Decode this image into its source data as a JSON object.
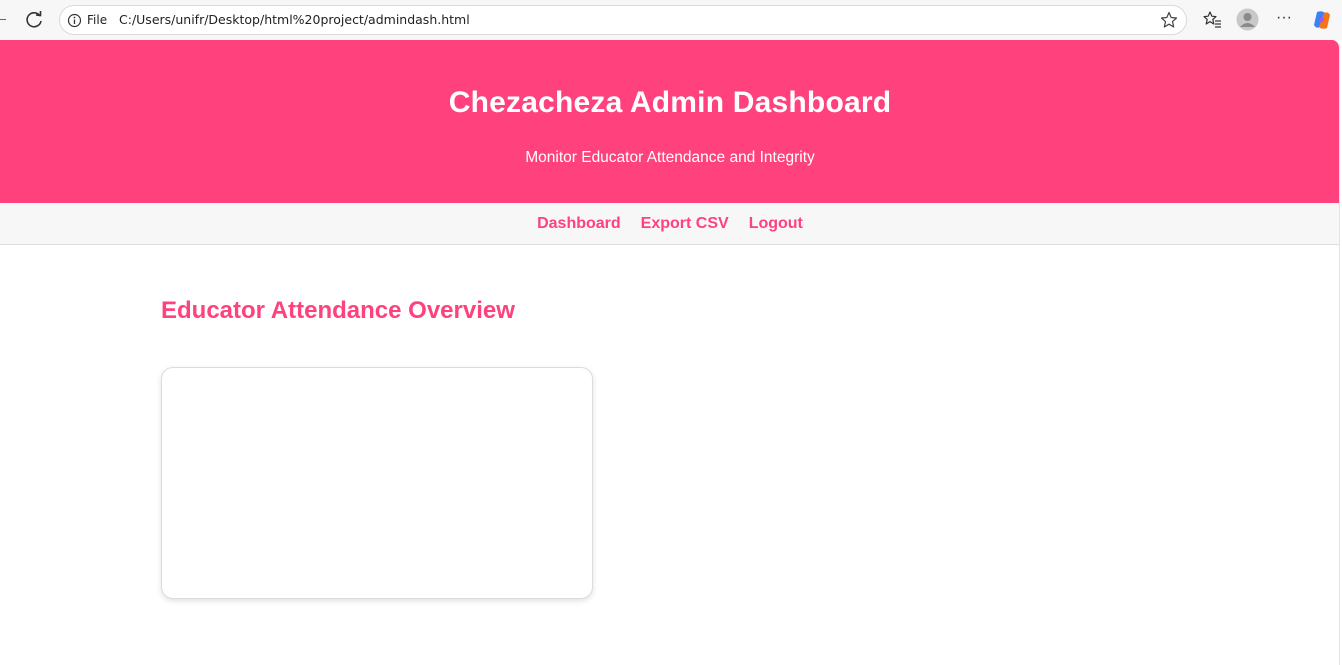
{
  "browser": {
    "file_label": "File",
    "url": "C:/Users/unifr/Desktop/html%20project/admindash.html",
    "more_glyph": "···"
  },
  "header": {
    "title": "Chezacheza Admin Dashboard",
    "subtitle": "Monitor Educator Attendance and Integrity"
  },
  "nav": {
    "items": [
      {
        "label": "Dashboard"
      },
      {
        "label": "Export CSV"
      },
      {
        "label": "Logout"
      }
    ]
  },
  "main": {
    "section_title": "Educator Attendance Overview"
  },
  "colors": {
    "brand": "#ff417e",
    "nav_bg": "#f7f7f7"
  }
}
